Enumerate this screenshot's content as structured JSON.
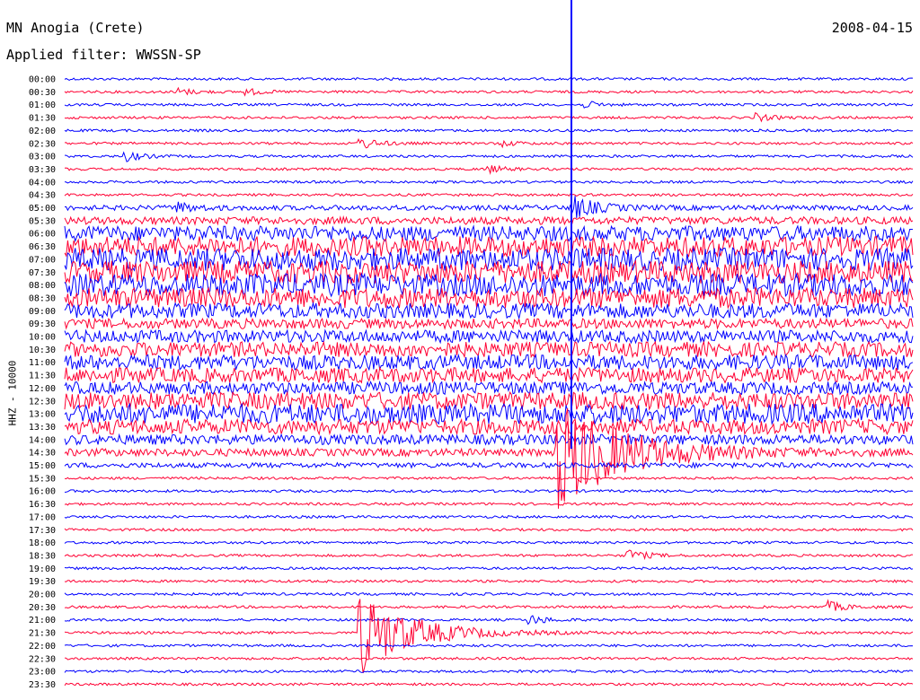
{
  "header": {
    "station": "MN Anogia (Crete)",
    "date": "2008-04-15",
    "filter": "Applied filter: WWSSN-SP"
  },
  "colors": {
    "trace_odd": "#0000ff",
    "trace_even": "#ff0033",
    "background": "#ffffff"
  },
  "chart_data": {
    "type": "line",
    "title": "MN Anogia (Crete)",
    "subtitle": "Applied filter: WWSSN-SP",
    "date": "2008-04-15",
    "ylabel": "HHZ - 10000",
    "xlabel": "",
    "minutes_per_trace": 30,
    "trace_colors": [
      "#0000ff",
      "#ff0033"
    ],
    "tick_labels": [
      "00:00",
      "00:30",
      "01:00",
      "01:30",
      "02:00",
      "02:30",
      "03:00",
      "03:30",
      "04:00",
      "04:30",
      "05:00",
      "05:30",
      "06:00",
      "06:30",
      "07:00",
      "07:30",
      "08:00",
      "08:30",
      "09:00",
      "09:30",
      "10:00",
      "10:30",
      "11:00",
      "11:30",
      "12:00",
      "12:30",
      "13:00",
      "13:30",
      "14:00",
      "14:30",
      "15:00",
      "15:30",
      "16:00",
      "16:30",
      "17:00",
      "17:30",
      "18:00",
      "18:30",
      "19:00",
      "19:30",
      "20:00",
      "20:30",
      "21:00",
      "21:30",
      "22:00",
      "22:30",
      "23:00",
      "23:30"
    ],
    "noise_level_per_trace": [
      1,
      1,
      1,
      1,
      1,
      1,
      1,
      1,
      1,
      1,
      2,
      3,
      6,
      8,
      9,
      9,
      9,
      8,
      6,
      4,
      5,
      6,
      6,
      6,
      5,
      7,
      8,
      6,
      4,
      3,
      2,
      1,
      1,
      1,
      1,
      1,
      1,
      1,
      1,
      1,
      1,
      1,
      1,
      1,
      1,
      1,
      1,
      1
    ],
    "events": [
      {
        "trace": "00:30",
        "minute": 4.0,
        "amplitude": 4
      },
      {
        "trace": "00:30",
        "minute": 6.5,
        "amplitude": 3
      },
      {
        "trace": "01:00",
        "minute": 18.5,
        "amplitude": 3
      },
      {
        "trace": "01:30",
        "minute": 24.5,
        "amplitude": 4
      },
      {
        "trace": "02:30",
        "minute": 10.5,
        "amplitude": 6
      },
      {
        "trace": "02:30",
        "minute": 15.5,
        "amplitude": 3
      },
      {
        "trace": "03:00",
        "minute": 2.2,
        "amplitude": 5
      },
      {
        "trace": "03:30",
        "minute": 15.0,
        "amplitude": 4
      },
      {
        "trace": "05:00",
        "minute": 4.0,
        "amplitude": 5
      },
      {
        "trace": "05:00",
        "minute": 18.0,
        "amplitude": 12
      },
      {
        "trace": "14:30",
        "minute": 17.5,
        "amplitude": 60
      },
      {
        "trace": "18:30",
        "minute": 20.0,
        "amplitude": 6
      },
      {
        "trace": "20:30",
        "minute": 27.0,
        "amplitude": 6
      },
      {
        "trace": "21:00",
        "minute": 16.5,
        "amplitude": 5
      },
      {
        "trace": "21:30",
        "minute": 10.5,
        "amplitude": 45
      }
    ]
  }
}
